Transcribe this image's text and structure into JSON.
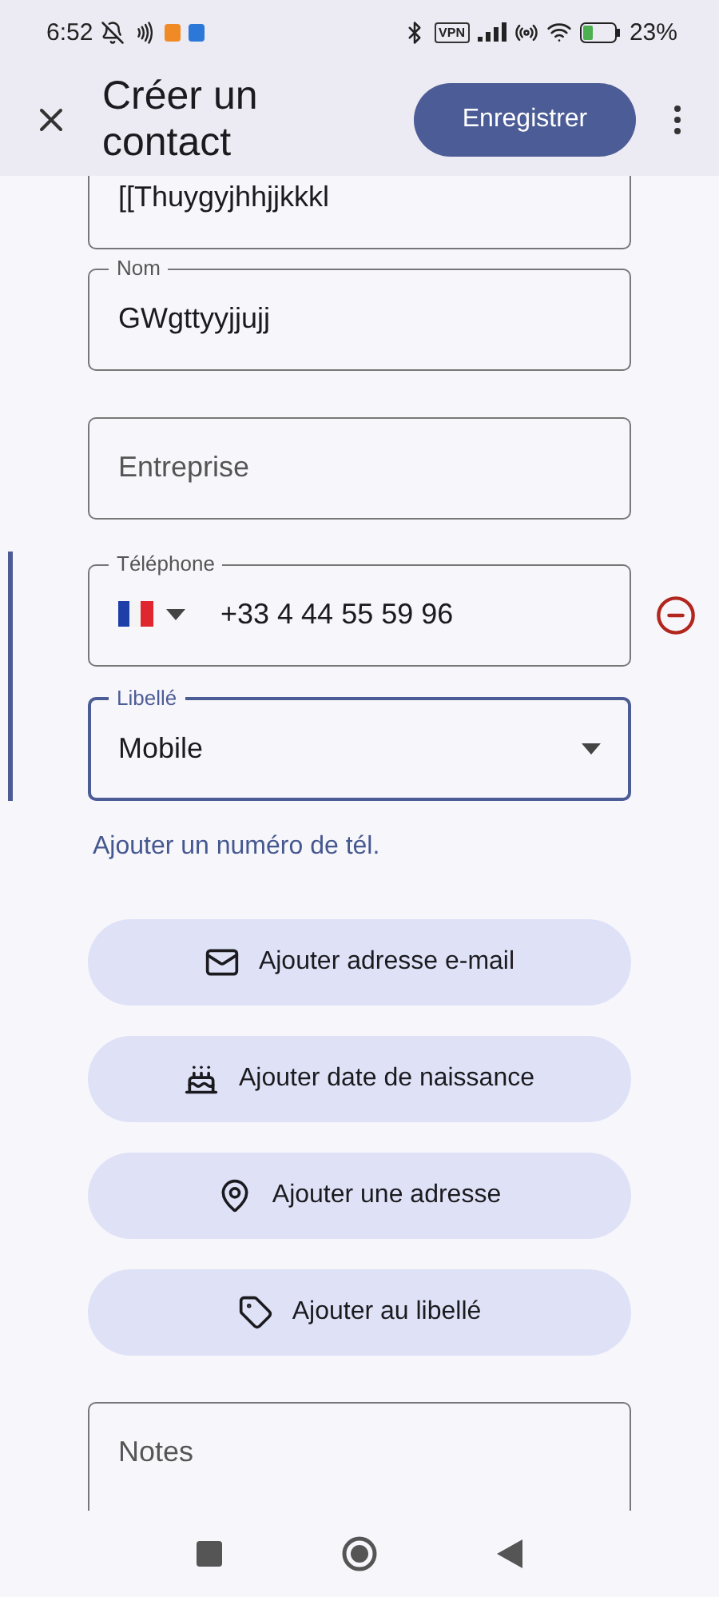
{
  "status_bar": {
    "time": "6:52",
    "vpn": "VPN",
    "battery": "23%"
  },
  "header": {
    "title": "Créer un contact",
    "save_button": "Enregistrer"
  },
  "fields": [
    {
      "kind": "text",
      "value": "[[Thuygyjhhjjkkkl",
      "focused": false
    },
    {
      "kind": "text",
      "label": "Nom",
      "value": "GWgttyyjjujj",
      "focused": false
    },
    {
      "kind": "text",
      "placeholder": "Entreprise",
      "focused": false
    }
  ],
  "phone": {
    "fields": [
      {
        "kind": "phone",
        "label": "Téléphone",
        "value": "+33 4 44 55 59 96",
        "focused": false
      },
      {
        "kind": "select",
        "label": "Libellé",
        "value": "Mobile",
        "focused": true
      }
    ]
  },
  "add_phone_link": "Ajouter un numéro de tél.",
  "actions": [
    {
      "kind": "email",
      "label": "Ajouter adresse e-mail"
    },
    {
      "kind": "birthday",
      "label": "Ajouter date de naissance"
    },
    {
      "kind": "address",
      "label": "Ajouter une adresse"
    },
    {
      "kind": "label",
      "label": "Ajouter au libellé"
    }
  ],
  "notes": {
    "placeholder": "Notes"
  }
}
